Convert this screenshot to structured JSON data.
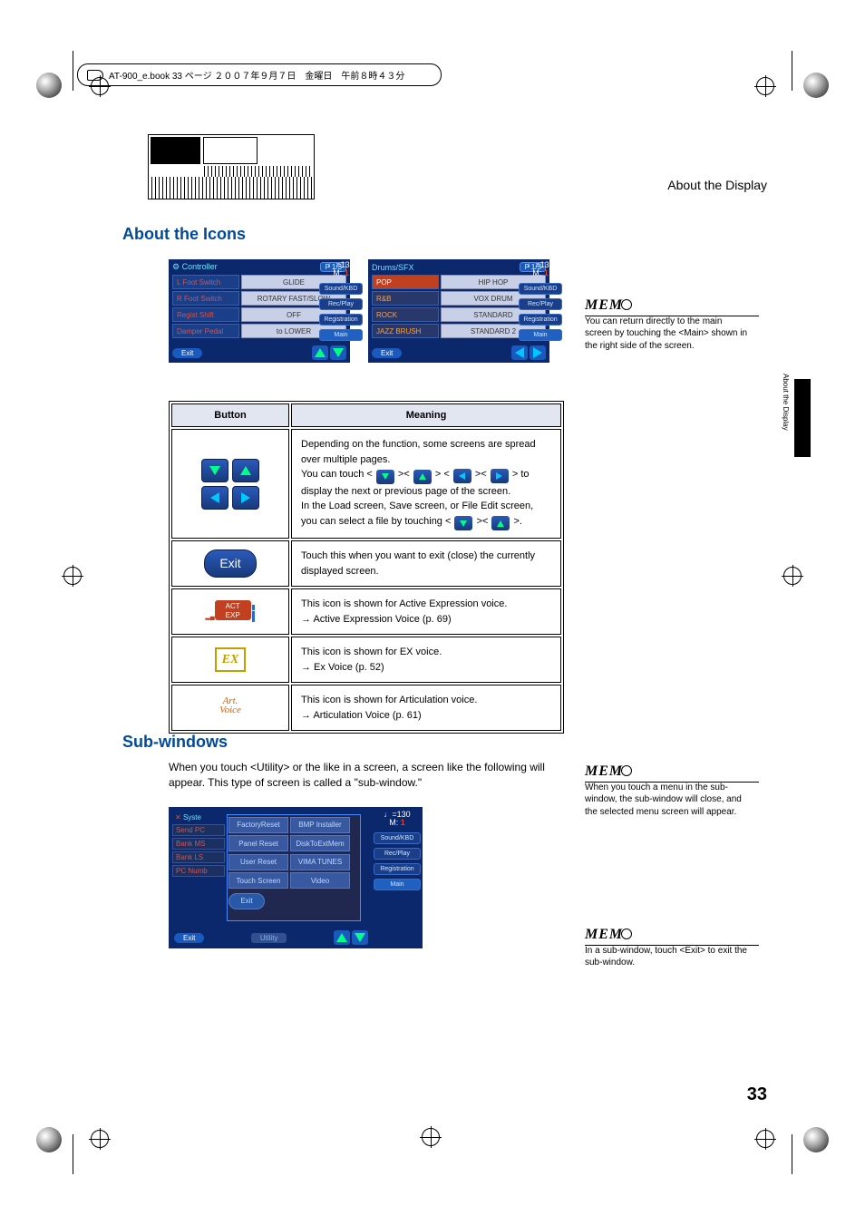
{
  "header_strip": "AT-900_e.book  33 ページ  ２００７年９月７日　金曜日　午前８時４３分",
  "section_path": "About the Display",
  "side_tab_text": "About the Display",
  "page_number": "33",
  "h_icons": "About the Icons",
  "h_subwin": "Sub-windows",
  "lcd1": {
    "title": "Controller",
    "page": "P 1/3",
    "rows": [
      {
        "l": "L Foot Switch",
        "r": "GLIDE"
      },
      {
        "l": "R Foot Switch",
        "r": "ROTARY FAST/SLOW"
      },
      {
        "l": "Regist Shift",
        "r": "OFF"
      },
      {
        "l": "Damper Pedal",
        "r": "to LOWER"
      }
    ],
    "exit": "Exit"
  },
  "lcd2": {
    "title": "Drums/SFX",
    "page": "P 1/3",
    "rows": [
      {
        "l": "POP",
        "r": "HIP HOP",
        "sel": true
      },
      {
        "l": "R&B",
        "r": "VOX DRUM"
      },
      {
        "l": "ROCK",
        "r": "STANDARD"
      },
      {
        "l": "JAZZ BRUSH",
        "r": "STANDARD 2"
      }
    ],
    "exit": "Exit"
  },
  "side_chips": {
    "tempo_note": "♩=130",
    "tempo_m": "M:",
    "tempo_val": "1",
    "sound": "Sound/KBD",
    "rec": "Rec/Play",
    "reg": "Registration",
    "main": "Main"
  },
  "table": {
    "h1": "Button",
    "h2": "Meaning",
    "r1a": "Depending on the function, some screens are spread over multiple pages.",
    "r1b": "You can touch < ",
    "r1c": " >< ",
    "r1d": " > < ",
    "r1e": " >< ",
    "r1f": " > to display the next or previous page of the screen.",
    "r1g": "In the Load screen, Save screen, or File Edit screen, you can select a file by touching < ",
    "r1h": " >< ",
    "r1i": " >.",
    "r2": "Touch this when you want to exit (close) the currently displayed screen.",
    "r3a": "This icon is shown for Active Expression voice.",
    "r3b": "→ Active Expression Voice (p. 69)",
    "r4a": "This icon is shown for EX voice.",
    "r4b": "→ Ex Voice (p. 52)",
    "r5a": "This icon is shown for Articulation voice.",
    "r5b": "→ Articulation Voice (p. 61)",
    "exit_label": "Exit",
    "exp_label": "ACT\nEXP",
    "ex_label": "EX",
    "art_label_1": "Art.",
    "art_label_2": "Voice"
  },
  "subwin_intro": "When you touch <Utility> or the like in a screen, a screen like the following will appear. This type of screen is called a \"sub-window.\"",
  "subwin": {
    "left_title": "Syste",
    "left_items": [
      "Send PC",
      "Bank MS",
      "Bank LS",
      "PC Numb"
    ],
    "left_exit": "Exit",
    "overlay": [
      [
        "FactoryReset",
        "BMP Installer"
      ],
      [
        "Panel Reset",
        "DiskToExtMem"
      ],
      [
        "User Reset",
        "VIMA TUNES"
      ],
      [
        "Touch Screen",
        "Video"
      ]
    ],
    "overlay_exit": "Exit",
    "overlay_bottom": "Utility"
  },
  "memo1": {
    "h": "MEMO",
    "t": "You can return directly to the main screen by touching the <Main> shown in the right side of the screen."
  },
  "memo2": {
    "h": "MEMO",
    "t": "When you touch a menu in the sub-window, the sub-window will close, and the selected menu screen will appear."
  },
  "memo3": {
    "h": "MEMO",
    "t": "In a sub-window, touch <Exit> to exit the sub-window."
  }
}
